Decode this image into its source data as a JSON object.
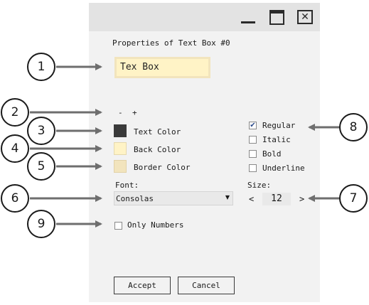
{
  "window": {
    "title": "Properties of Text Box #0",
    "controls": {
      "minimize": "minimize-icon",
      "maximize": "maximize-icon",
      "close": "close-icon"
    }
  },
  "textbox": {
    "value": "Tex Box"
  },
  "size_adjust": {
    "minus": "-",
    "plus": "+"
  },
  "colors": {
    "text": {
      "label": "Text Color",
      "value": "#3a3a3a"
    },
    "back": {
      "label": "Back Color",
      "value": "#fff3c6"
    },
    "border": {
      "label": "Border Color",
      "value": "#f2e4bd"
    }
  },
  "styles": [
    {
      "label": "Regular",
      "checked": true
    },
    {
      "label": "Italic",
      "checked": false
    },
    {
      "label": "Bold",
      "checked": false
    },
    {
      "label": "Underline",
      "checked": false
    }
  ],
  "font": {
    "label": "Font:",
    "value": "Consolas"
  },
  "size": {
    "label": "Size:",
    "value": "12",
    "prev": "<",
    "next": ">"
  },
  "only_numbers": {
    "label": "Only Numbers",
    "checked": false
  },
  "buttons": {
    "accept": "Accept",
    "cancel": "Cancel"
  },
  "callouts": [
    "1",
    "2",
    "3",
    "4",
    "5",
    "6",
    "7",
    "8",
    "9"
  ]
}
